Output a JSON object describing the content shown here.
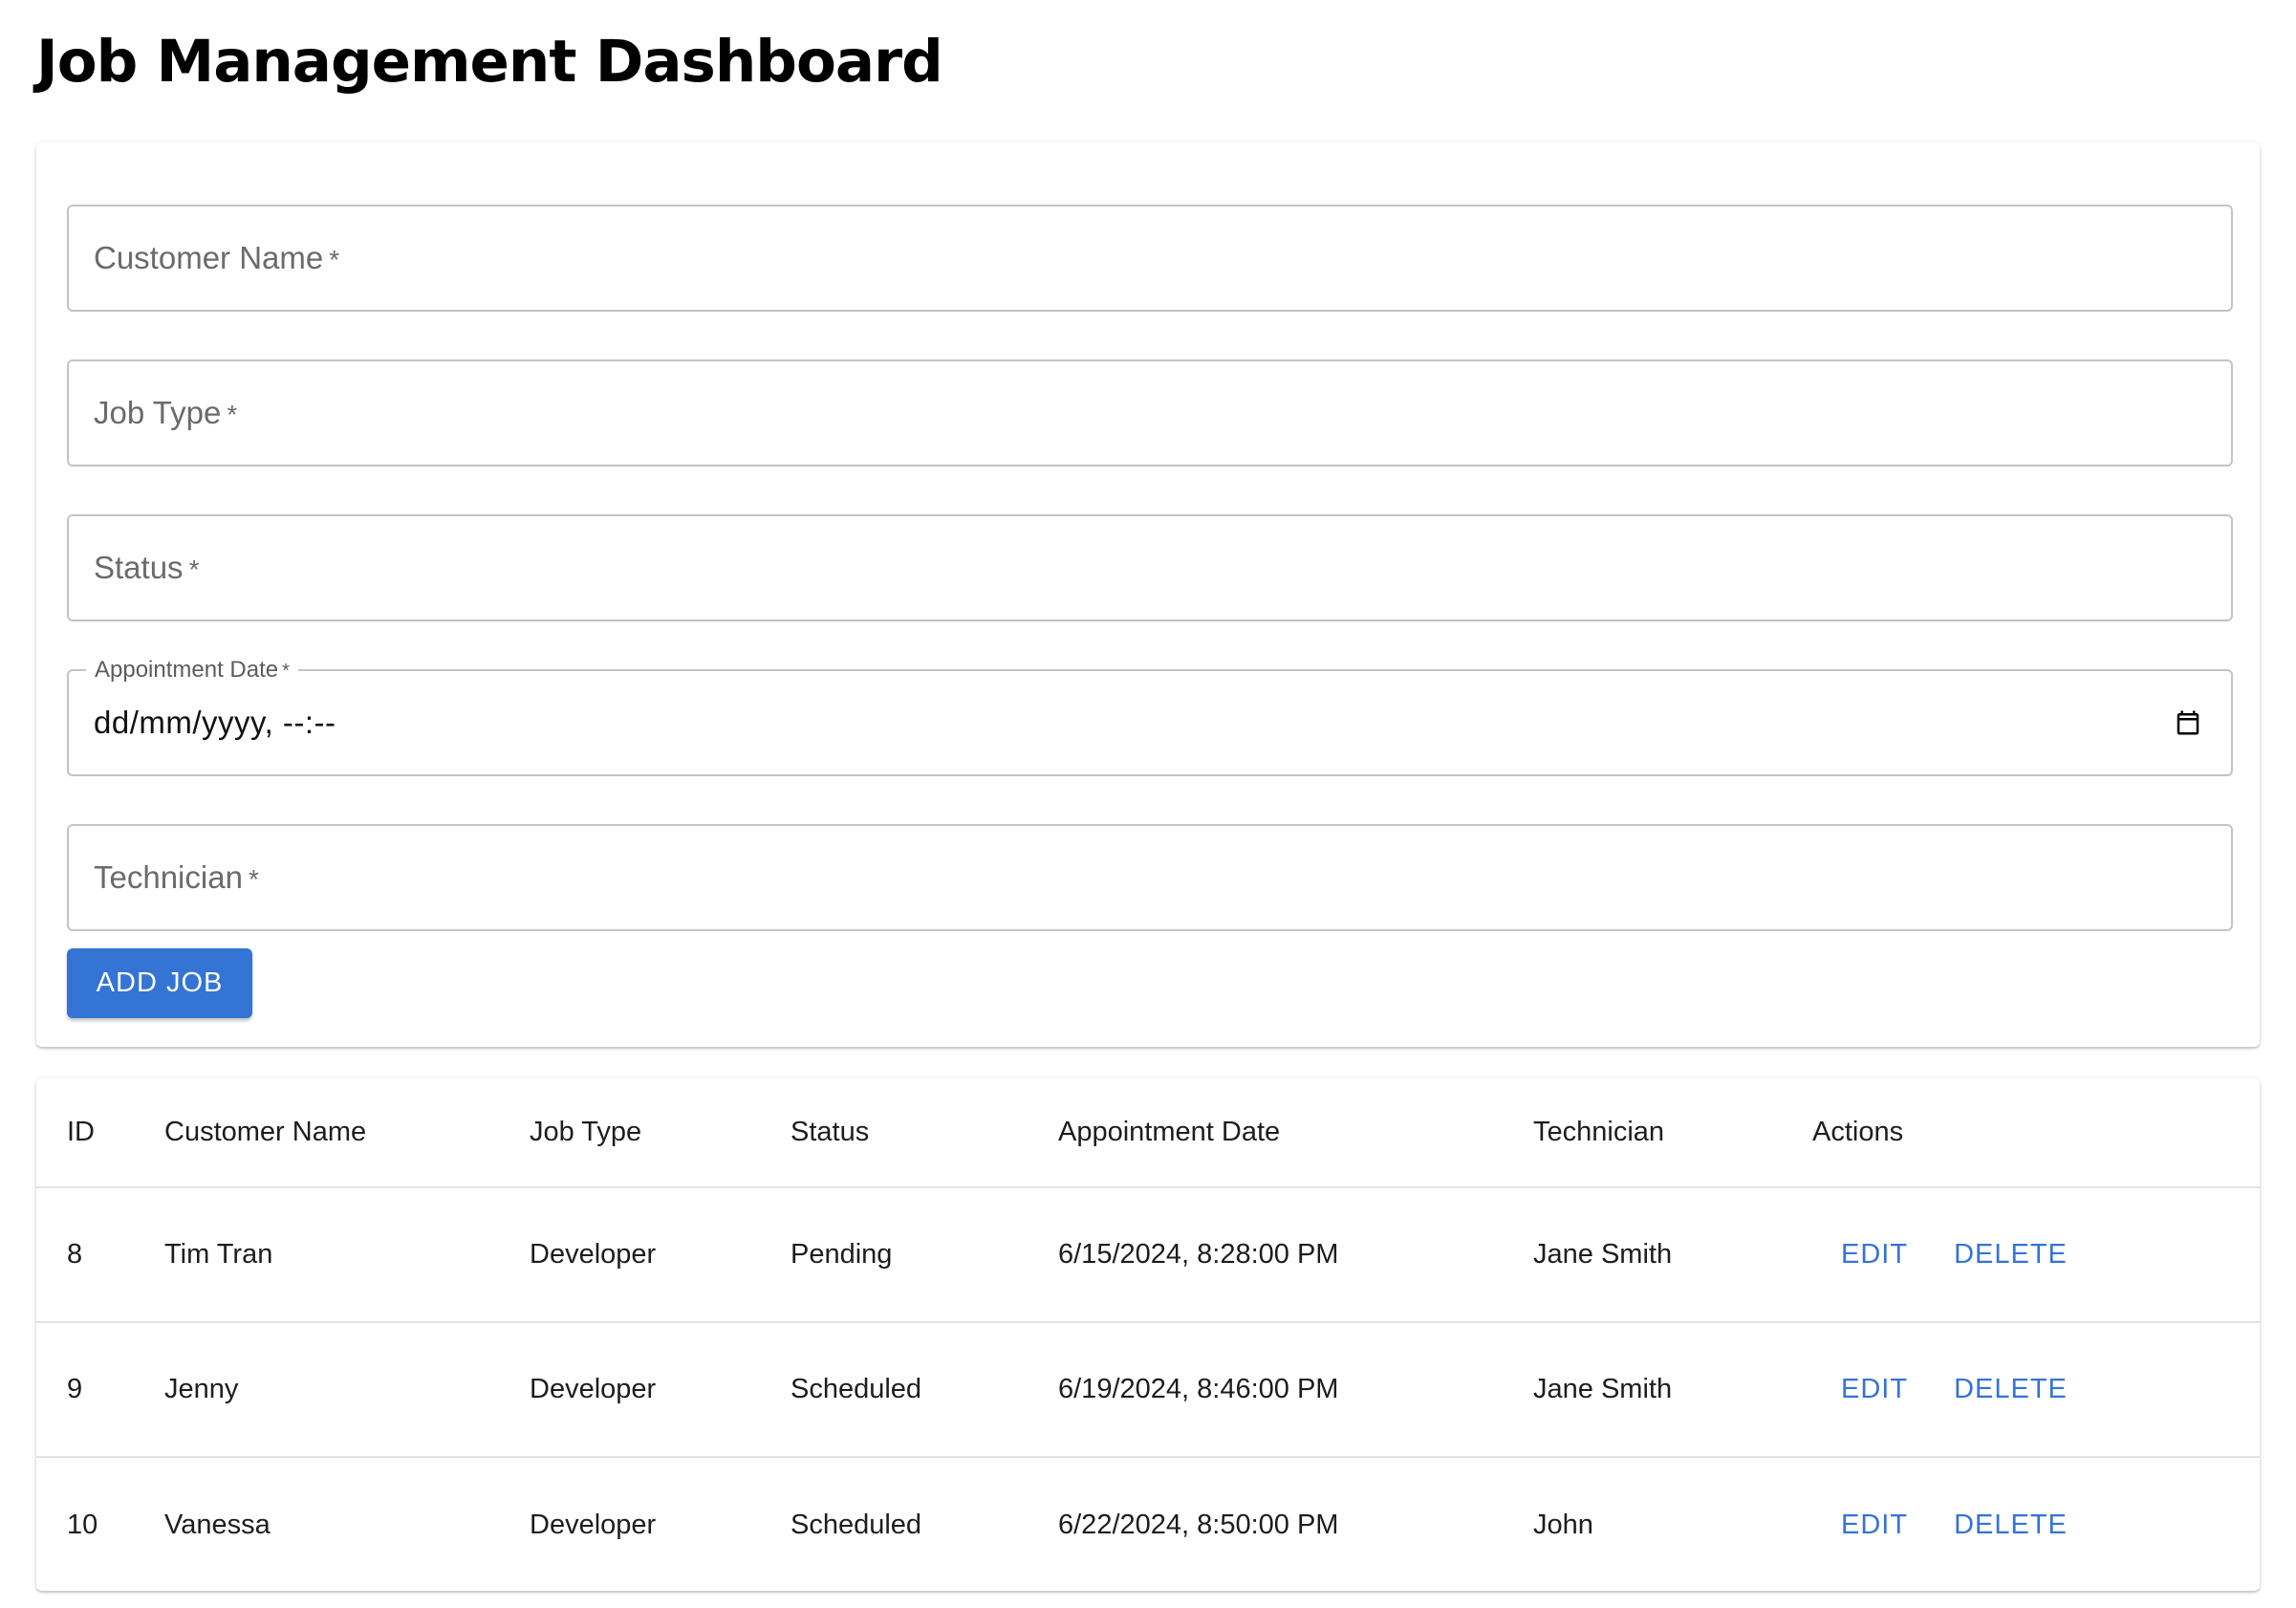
{
  "page": {
    "title": "Job Management Dashboard"
  },
  "form": {
    "customer_name": {
      "label": "Customer Name",
      "required_marker": "*",
      "value": ""
    },
    "job_type": {
      "label": "Job Type",
      "required_marker": "*",
      "value": ""
    },
    "status": {
      "label": "Status",
      "required_marker": "*",
      "value": ""
    },
    "appointment_date": {
      "label": "Appointment Date",
      "required_marker": "*",
      "display_value": "dd/mm/yyyy, --:--",
      "icon": "calendar-icon"
    },
    "technician": {
      "label": "Technician",
      "required_marker": "*",
      "value": ""
    },
    "add_button_label": "ADD JOB"
  },
  "table": {
    "headers": {
      "id": "ID",
      "customer_name": "Customer Name",
      "job_type": "Job Type",
      "status": "Status",
      "appointment_date": "Appointment Date",
      "technician": "Technician",
      "actions": "Actions"
    },
    "rows": [
      {
        "id": "8",
        "customer_name": "Tim Tran",
        "job_type": "Developer",
        "status": "Pending",
        "appointment_date": "6/15/2024, 8:28:00 PM",
        "technician": "Jane Smith",
        "edit_label": "EDIT",
        "delete_label": "DELETE"
      },
      {
        "id": "9",
        "customer_name": "Jenny",
        "job_type": "Developer",
        "status": "Scheduled",
        "appointment_date": "6/19/2024, 8:46:00 PM",
        "technician": "Jane Smith",
        "edit_label": "EDIT",
        "delete_label": "DELETE"
      },
      {
        "id": "10",
        "customer_name": "Vanessa",
        "job_type": "Developer",
        "status": "Scheduled",
        "appointment_date": "6/22/2024, 8:50:00 PM",
        "technician": "John",
        "edit_label": "EDIT",
        "delete_label": "DELETE"
      }
    ]
  },
  "colors": {
    "primary": "#3474d4",
    "border": "#c4c4c4",
    "divider": "#e3e3e3"
  }
}
